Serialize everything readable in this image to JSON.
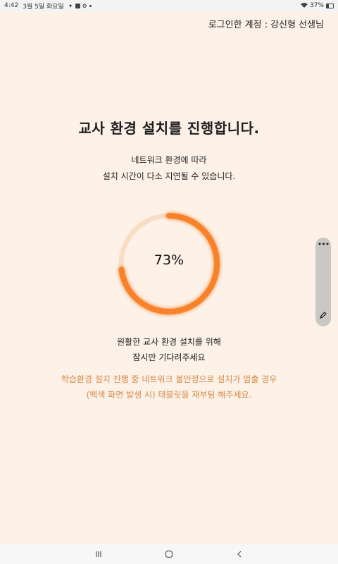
{
  "status_bar": {
    "time": "4:42",
    "date": "3월 5일 화요일",
    "battery": "37%"
  },
  "login": {
    "label": "로그인한 계정 :",
    "user": "강신형 선생님"
  },
  "main": {
    "title": "교사 환경 설치를 진행합니다.",
    "subtitle_line1": "네트워크 환경에 따라",
    "subtitle_line2": "설치 시간이 다소 지연될 수 있습니다.",
    "progress_percent": 73,
    "progress_label": "73%",
    "wait_line1": "원활한 교사 환경 설치를 위해",
    "wait_line2": "잠시만 기다려주세요",
    "warn_line1": "학습환경 설치 진행 중 네트워크 불안정으로 설치가 멈출 경우",
    "warn_line2": "(백색 화면 발생 시) 태블릿을 재부팅 해주세요."
  },
  "colors": {
    "background": "#fdf1e8",
    "progress": "#f7822a",
    "progress_track": "#f9dcc4",
    "warning_text": "#d98b46"
  },
  "icons": {
    "side_menu": "more-dots-icon",
    "side_edit": "edit-pen-icon",
    "nav_recent": "recent-apps-icon",
    "nav_home": "home-icon",
    "nav_back": "back-icon"
  }
}
